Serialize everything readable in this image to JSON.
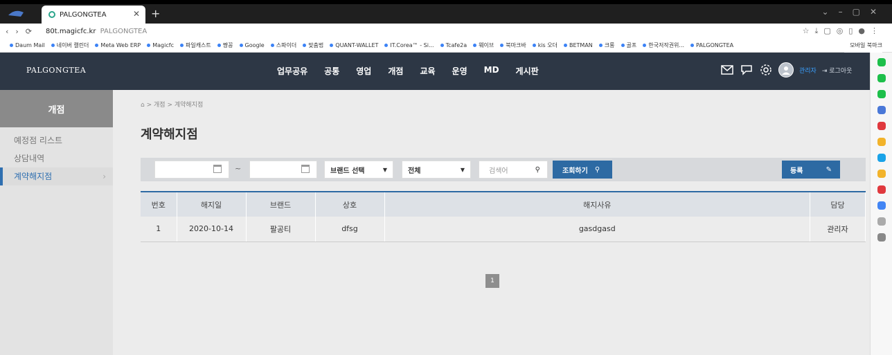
{
  "browser": {
    "tab_title": "PALGONGTEA",
    "url_domain": "80t.magicfc.kr",
    "url_title": "PALGONGTEA",
    "bookmarks": [
      "Daum Mail",
      "네이버 캘린더",
      "Meta Web ERP",
      "Magicfc",
      "파일캐스트",
      "쨩꽁",
      "Google",
      "스파이더",
      "맞춤법",
      "QUANT-WALLET",
      "IT.Corea™ - Si...",
      "Tcafe2a",
      "웨이브",
      "북마크바",
      "kis 오더",
      "BETMAN",
      "크롱",
      "골프",
      "한국저작권위...",
      "PALGONGTEA"
    ],
    "bookmarks_right": "모바일 북마크"
  },
  "app": {
    "brand": "PALGONGTEA",
    "menu": [
      "업무공유",
      "공통",
      "영업",
      "개점",
      "교육",
      "운영",
      "MD",
      "게시판"
    ],
    "user": "관리자",
    "logout": "로그아웃"
  },
  "sidebar": {
    "title": "개점",
    "items": [
      "예정점 리스트",
      "상담내역",
      "계약해지점"
    ]
  },
  "breadcrumb": {
    "level1": "개점",
    "level2": "계약해지점",
    "sep": ">"
  },
  "page_title": "계약해지점",
  "filter": {
    "tilde": "~",
    "brand_select": "브랜드 선택",
    "all_select": "전체",
    "search_placeholder": "검색어",
    "search_button": "조회하기",
    "register_button": "등록"
  },
  "table": {
    "headers": [
      "번호",
      "해지일",
      "브랜드",
      "상호",
      "해지사유",
      "담당"
    ],
    "rows": [
      [
        "1",
        "2020-10-14",
        "팔공티",
        "dfsg",
        "gasdgasd",
        "관리자"
      ]
    ]
  },
  "pagination": {
    "current": "1"
  }
}
